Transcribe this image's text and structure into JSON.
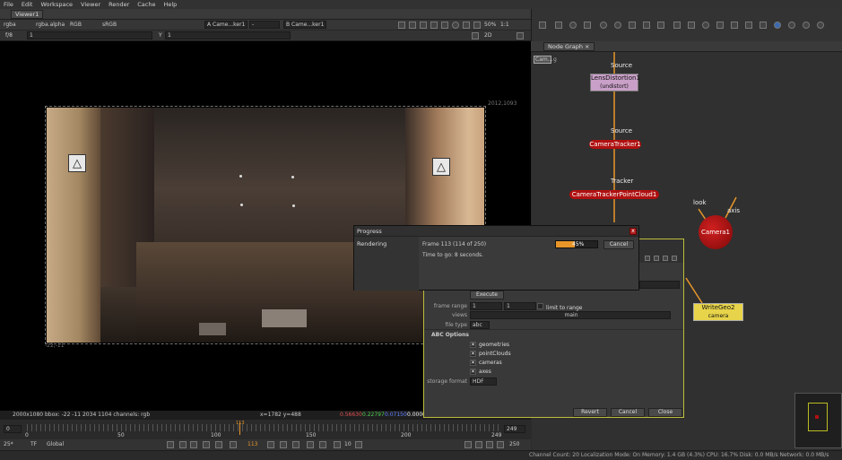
{
  "menu": [
    "File",
    "Edit",
    "Workspace",
    "Viewer",
    "Render",
    "Cache",
    "Help"
  ],
  "viewer_tab": "Viewer1",
  "viewer_toolbar": {
    "channels": "rgba",
    "alpha": "rgba.alpha",
    "colorspace": "RGB",
    "lut": "sRGB",
    "input_a": "A  Came...ker1",
    "input_a_op": "-",
    "input_b": "B  Came...ker1",
    "zoom": "50%",
    "ratio": "1:1",
    "mode": "2D",
    "fstop": "f/8",
    "gain": "1",
    "gamma_label": "Y",
    "gamma": "1"
  },
  "viewer": {
    "resolution_label": "2012,1093",
    "bottom_left_label": "-22,-11"
  },
  "info_bar": {
    "format": "2000x1080  bbox: -22 -11 2034 1104 channels: rgb",
    "coords": "x=1782 y=488",
    "r": "0.56630",
    "g": "0.22797",
    "b": "0.07150",
    "a": "0.00000"
  },
  "timeline": {
    "start": "0",
    "end": "249",
    "ticks": [
      "0",
      "50",
      "100",
      "150",
      "200",
      "249"
    ],
    "current_marker": "113",
    "fps": "25*",
    "tf": "TF",
    "scope": "Global",
    "current_frame": "113",
    "step": "10",
    "end_frame": "250"
  },
  "status_bar": "Channel Count: 20  Localization Mode: On  Memory: 1.4 GB (4.3%)  CPU: 16.7%  Disk: 0.0 MB/s  Network: 0.0 MB/s",
  "node_graph": {
    "tab": "Node Graph",
    "tag_label": "Cam...",
    "tag_suffix": "g",
    "nodes": {
      "lens": "LensDistortion1",
      "lens_sub": "(undistort)",
      "tracker": "CameraTracker1",
      "pointcloud": "CameraTrackerPointCloud1",
      "camera": "Camera1",
      "writegeo": "WriteGeo2",
      "writegeo_sub": "camera"
    },
    "edge_labels": {
      "source1": "Source",
      "source2": "Source",
      "tracker": "Tracker",
      "look": "look",
      "axis": "axis"
    }
  },
  "progress_dialog": {
    "title": "Progress",
    "task": "Rendering",
    "frame_text": "Frame 113 (114 of 250)",
    "percent_text": "45%",
    "progress": 0.45,
    "time_to_go": "Time to go: 8 seconds.",
    "cancel": "Cancel",
    "close": "x"
  },
  "write_panel": {
    "execute": "Execute",
    "frame_range_label": "frame range",
    "frame_range_a": "1",
    "frame_range_b": "1",
    "limit_to_range": "limit to range",
    "views_label": "views",
    "views_value": "main",
    "file_type_label": "file type",
    "file_type_value": "abc",
    "abc_options": "ABC Options",
    "options": [
      "geometries",
      "pointClouds",
      "cameras",
      "axes"
    ],
    "storage_format_label": "storage format",
    "storage_format_value": "HDF",
    "revert": "Revert",
    "cancel": "Cancel",
    "close": "Close"
  },
  "colors": {
    "accent_orange": "#e8962a",
    "node_red": "#b01010",
    "lens_pink": "#c9a0c8",
    "writegeo_yellow": "#e8d44a"
  }
}
